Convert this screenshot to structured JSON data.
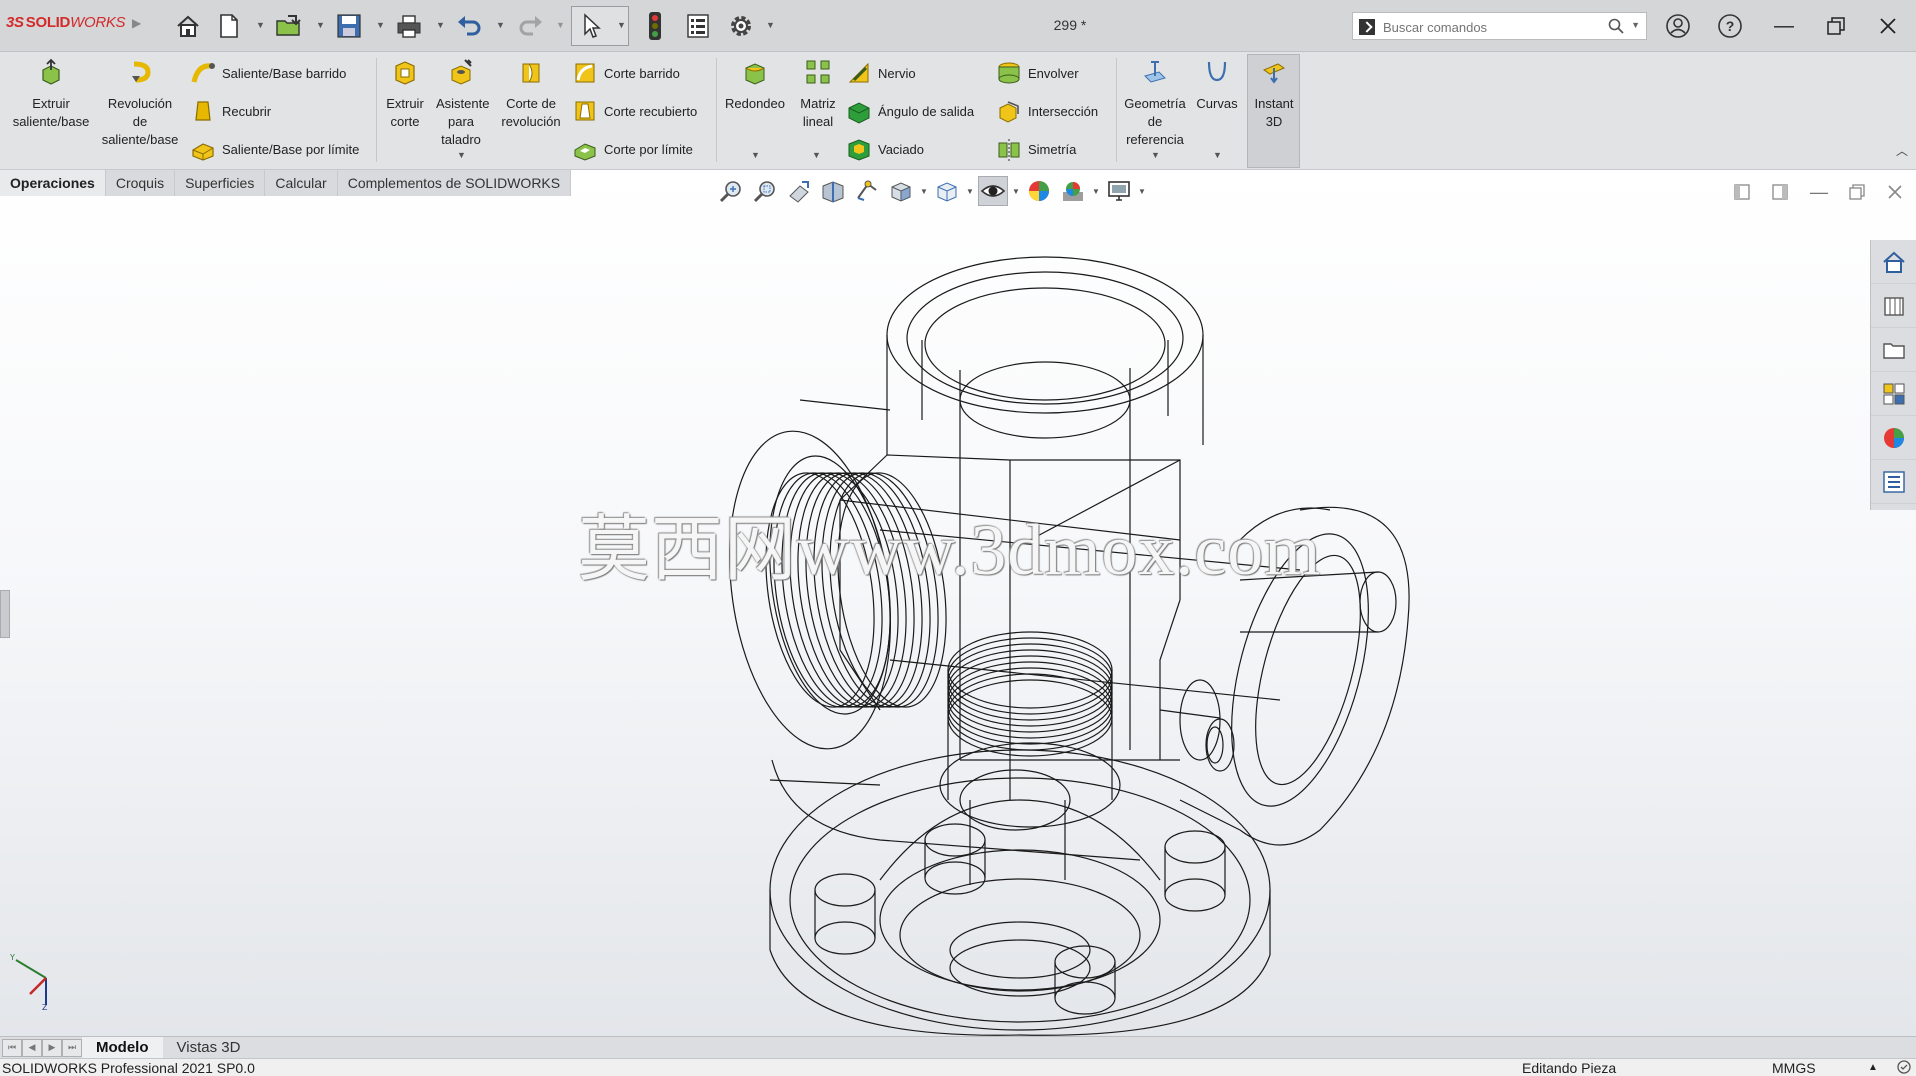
{
  "app": {
    "brand_ds": "3S",
    "brand_solid": "SOLID",
    "brand_works": "WORKS",
    "document_title": "299 *"
  },
  "search": {
    "placeholder": "Buscar comandos"
  },
  "ribbon": {
    "extrude_boss": "Extruir saliente/base",
    "revolve_boss": "Revolución de saliente/base",
    "swept_boss": "Saliente/Base barrido",
    "loft_boss": "Recubrir",
    "boundary_boss": "Saliente/Base por límite",
    "extrude_cut": "Extruir corte",
    "hole_wizard": "Asistente para taladro",
    "revolve_cut": "Corte de revolución",
    "swept_cut": "Corte barrido",
    "loft_cut": "Corte recubierto",
    "boundary_cut": "Corte por límite",
    "fillet": "Redondeo",
    "linear_pattern": "Matriz lineal",
    "rib": "Nervio",
    "draft": "Ángulo de salida",
    "shell": "Vaciado",
    "wrap": "Envolver",
    "intersect": "Intersección",
    "mirror": "Simetría",
    "ref_geometry": "Geometría de referencia",
    "curves": "Curvas",
    "instant3d": "Instant 3D"
  },
  "command_tabs": [
    "Operaciones",
    "Croquis",
    "Superficies",
    "Calcular",
    "Complementos de SOLIDWORKS"
  ],
  "watermark": "莫西网www.3dmox.com",
  "bottom_tabs": [
    "Modelo",
    "Vistas 3D"
  ],
  "status": {
    "product": "SOLIDWORKS Professional 2021 SP0.0",
    "mode": "Editando Pieza",
    "units": "MMGS"
  },
  "colors": {
    "brand_red": "#d32a2a",
    "ribbon_bg": "#e2e3e5",
    "viewport_top": "#ffffff",
    "viewport_bottom": "#e3e6ea"
  }
}
